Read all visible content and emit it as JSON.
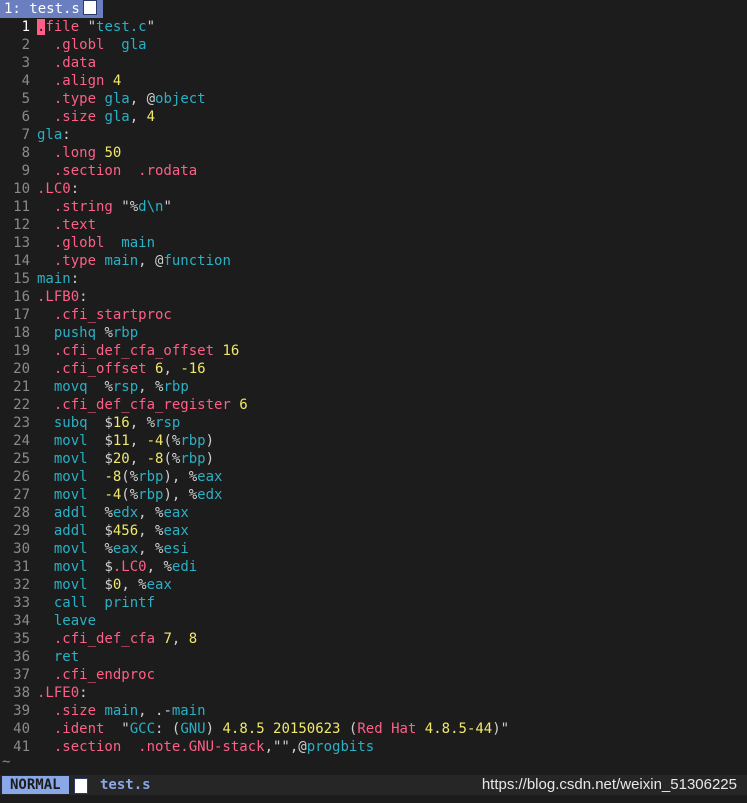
{
  "tab": {
    "label": "1: test.s",
    "icon": "file-type-icon"
  },
  "lines": [
    [
      [
        "cursor",
        "."
      ],
      [
        "dir",
        "file "
      ],
      [
        "str",
        "\""
      ],
      [
        "lbl",
        "test.c"
      ],
      [
        "str",
        "\""
      ]
    ],
    [
      [
        "plain",
        "  "
      ],
      [
        "dir",
        ".globl  "
      ],
      [
        "lbl",
        "gla"
      ]
    ],
    [
      [
        "plain",
        "  "
      ],
      [
        "dir",
        ".data"
      ]
    ],
    [
      [
        "plain",
        "  "
      ],
      [
        "dir",
        ".align "
      ],
      [
        "num",
        "4"
      ]
    ],
    [
      [
        "plain",
        "  "
      ],
      [
        "dir",
        ".type "
      ],
      [
        "lbl",
        "gla"
      ],
      [
        "plain",
        ", @"
      ],
      [
        "lbl",
        "object"
      ]
    ],
    [
      [
        "plain",
        "  "
      ],
      [
        "dir",
        ".size "
      ],
      [
        "lbl",
        "gla"
      ],
      [
        "plain",
        ", "
      ],
      [
        "num",
        "4"
      ]
    ],
    [
      [
        "lbl",
        "gla"
      ],
      [
        "plain",
        ":"
      ]
    ],
    [
      [
        "plain",
        "  "
      ],
      [
        "dir",
        ".long "
      ],
      [
        "num",
        "50"
      ]
    ],
    [
      [
        "plain",
        "  "
      ],
      [
        "dir",
        ".section  .rodata"
      ]
    ],
    [
      [
        "dir",
        ".LC0"
      ],
      [
        "plain",
        ":"
      ]
    ],
    [
      [
        "plain",
        "  "
      ],
      [
        "dir",
        ".string "
      ],
      [
        "str",
        "\"%"
      ],
      [
        "lbl",
        "d"
      ],
      [
        "esc",
        "\\n"
      ],
      [
        "str",
        "\""
      ]
    ],
    [
      [
        "plain",
        "  "
      ],
      [
        "dir",
        ".text"
      ]
    ],
    [
      [
        "plain",
        "  "
      ],
      [
        "dir",
        ".globl  "
      ],
      [
        "lbl",
        "main"
      ]
    ],
    [
      [
        "plain",
        "  "
      ],
      [
        "dir",
        ".type "
      ],
      [
        "lbl",
        "main"
      ],
      [
        "plain",
        ", @"
      ],
      [
        "lbl",
        "function"
      ]
    ],
    [
      [
        "lbl",
        "main"
      ],
      [
        "plain",
        ":"
      ]
    ],
    [
      [
        "dir",
        ".LFB0"
      ],
      [
        "plain",
        ":"
      ]
    ],
    [
      [
        "plain",
        "  "
      ],
      [
        "dir",
        ".cfi_startproc"
      ]
    ],
    [
      [
        "plain",
        "  "
      ],
      [
        "ins",
        "pushq "
      ],
      [
        "plain",
        "%"
      ],
      [
        "reg",
        "rbp"
      ]
    ],
    [
      [
        "plain",
        "  "
      ],
      [
        "dir",
        ".cfi_def_cfa_offset "
      ],
      [
        "num",
        "16"
      ]
    ],
    [
      [
        "plain",
        "  "
      ],
      [
        "dir",
        ".cfi_offset "
      ],
      [
        "num",
        "6"
      ],
      [
        "plain",
        ", "
      ],
      [
        "num",
        "-16"
      ]
    ],
    [
      [
        "plain",
        "  "
      ],
      [
        "ins",
        "movq  "
      ],
      [
        "plain",
        "%"
      ],
      [
        "reg",
        "rsp"
      ],
      [
        "plain",
        ", %"
      ],
      [
        "reg",
        "rbp"
      ]
    ],
    [
      [
        "plain",
        "  "
      ],
      [
        "dir",
        ".cfi_def_cfa_register "
      ],
      [
        "num",
        "6"
      ]
    ],
    [
      [
        "plain",
        "  "
      ],
      [
        "ins",
        "subq  "
      ],
      [
        "plain",
        "$"
      ],
      [
        "num",
        "16"
      ],
      [
        "plain",
        ", %"
      ],
      [
        "reg",
        "rsp"
      ]
    ],
    [
      [
        "plain",
        "  "
      ],
      [
        "ins",
        "movl  "
      ],
      [
        "plain",
        "$"
      ],
      [
        "num",
        "11"
      ],
      [
        "plain",
        ", "
      ],
      [
        "num",
        "-4"
      ],
      [
        "plain",
        "(%"
      ],
      [
        "reg",
        "rbp"
      ],
      [
        "plain",
        ")"
      ]
    ],
    [
      [
        "plain",
        "  "
      ],
      [
        "ins",
        "movl  "
      ],
      [
        "plain",
        "$"
      ],
      [
        "num",
        "20"
      ],
      [
        "plain",
        ", "
      ],
      [
        "num",
        "-8"
      ],
      [
        "plain",
        "(%"
      ],
      [
        "reg",
        "rbp"
      ],
      [
        "plain",
        ")"
      ]
    ],
    [
      [
        "plain",
        "  "
      ],
      [
        "ins",
        "movl  "
      ],
      [
        "num",
        "-8"
      ],
      [
        "plain",
        "(%"
      ],
      [
        "reg",
        "rbp"
      ],
      [
        "plain",
        "), %"
      ],
      [
        "reg",
        "eax"
      ]
    ],
    [
      [
        "plain",
        "  "
      ],
      [
        "ins",
        "movl  "
      ],
      [
        "num",
        "-4"
      ],
      [
        "plain",
        "(%"
      ],
      [
        "reg",
        "rbp"
      ],
      [
        "plain",
        "), %"
      ],
      [
        "reg",
        "edx"
      ]
    ],
    [
      [
        "plain",
        "  "
      ],
      [
        "ins",
        "addl  "
      ],
      [
        "plain",
        "%"
      ],
      [
        "reg",
        "edx"
      ],
      [
        "plain",
        ", %"
      ],
      [
        "reg",
        "eax"
      ]
    ],
    [
      [
        "plain",
        "  "
      ],
      [
        "ins",
        "addl  "
      ],
      [
        "plain",
        "$"
      ],
      [
        "num",
        "456"
      ],
      [
        "plain",
        ", %"
      ],
      [
        "reg",
        "eax"
      ]
    ],
    [
      [
        "plain",
        "  "
      ],
      [
        "ins",
        "movl  "
      ],
      [
        "plain",
        "%"
      ],
      [
        "reg",
        "eax"
      ],
      [
        "plain",
        ", %"
      ],
      [
        "reg",
        "esi"
      ]
    ],
    [
      [
        "plain",
        "  "
      ],
      [
        "ins",
        "movl  "
      ],
      [
        "plain",
        "$"
      ],
      [
        "dir",
        ".LC0"
      ],
      [
        "plain",
        ", %"
      ],
      [
        "reg",
        "edi"
      ]
    ],
    [
      [
        "plain",
        "  "
      ],
      [
        "ins",
        "movl  "
      ],
      [
        "plain",
        "$"
      ],
      [
        "num",
        "0"
      ],
      [
        "plain",
        ", %"
      ],
      [
        "reg",
        "eax"
      ]
    ],
    [
      [
        "plain",
        "  "
      ],
      [
        "ins",
        "call  printf"
      ]
    ],
    [
      [
        "plain",
        "  "
      ],
      [
        "ins",
        "leave"
      ]
    ],
    [
      [
        "plain",
        "  "
      ],
      [
        "dir",
        ".cfi_def_cfa "
      ],
      [
        "num",
        "7"
      ],
      [
        "plain",
        ", "
      ],
      [
        "num",
        "8"
      ]
    ],
    [
      [
        "plain",
        "  "
      ],
      [
        "ins",
        "ret"
      ]
    ],
    [
      [
        "plain",
        "  "
      ],
      [
        "dir",
        ".cfi_endproc"
      ]
    ],
    [
      [
        "dir",
        ".LFE0"
      ],
      [
        "plain",
        ":"
      ]
    ],
    [
      [
        "plain",
        "  "
      ],
      [
        "dir",
        ".size "
      ],
      [
        "lbl",
        "main"
      ],
      [
        "plain",
        ", .-"
      ],
      [
        "lbl",
        "main"
      ]
    ],
    [
      [
        "plain",
        "  "
      ],
      [
        "dir",
        ".ident  "
      ],
      [
        "str",
        "\""
      ],
      [
        "lbl",
        "GCC"
      ],
      [
        "str",
        ": ("
      ],
      [
        "lbl",
        "GNU"
      ],
      [
        "str",
        ") "
      ],
      [
        "num",
        "4.8.5 20150623"
      ],
      [
        "str",
        " ("
      ],
      [
        "dir",
        "Red Hat "
      ],
      [
        "num",
        "4.8.5-44"
      ],
      [
        "str",
        ")\""
      ]
    ],
    [
      [
        "plain",
        "  "
      ],
      [
        "dir",
        ".section  .note.GNU-stack"
      ],
      [
        "plain",
        ",\"\",@"
      ],
      [
        "lbl",
        "progbits"
      ]
    ]
  ],
  "empty_marker": "~",
  "status": {
    "mode": "NORMAL",
    "filename": "test.s",
    "icon": "file-type-icon"
  },
  "watermark": "https://blog.csdn.net/weixin_51306225",
  "colors": {
    "background": "#1c1c1c",
    "directive": "#ff5f87",
    "label": "#2ab0c4",
    "number": "#f0e86a",
    "mode_bg": "#8aa8e8",
    "tab_bg": "#6a7ec0"
  }
}
